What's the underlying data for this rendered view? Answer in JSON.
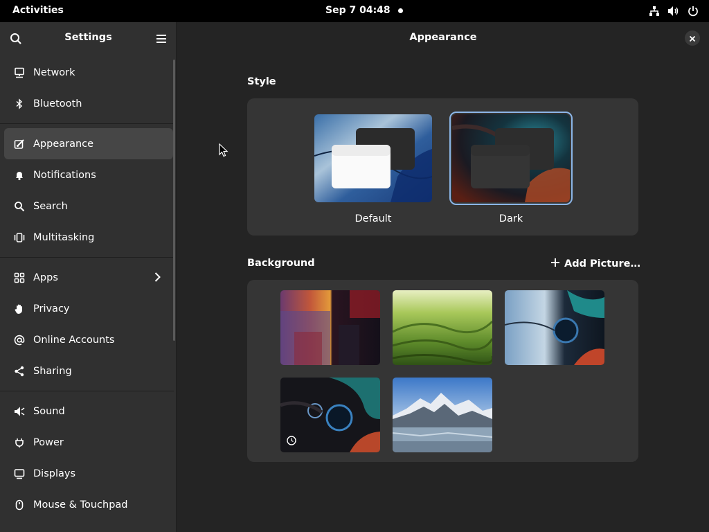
{
  "topbar": {
    "activities": "Activities",
    "clock": "Sep 7  04:48",
    "tray_icons": [
      "network-wired-icon",
      "volume-icon",
      "power-icon"
    ]
  },
  "sidebar": {
    "title": "Settings",
    "items": [
      {
        "label": "Network",
        "icon": "network-icon"
      },
      {
        "label": "Bluetooth",
        "icon": "bluetooth-icon"
      },
      {
        "label": "Appearance",
        "icon": "appearance-icon",
        "active": true
      },
      {
        "label": "Notifications",
        "icon": "bell-icon"
      },
      {
        "label": "Search",
        "icon": "search-icon"
      },
      {
        "label": "Multitasking",
        "icon": "multitasking-icon"
      },
      {
        "label": "Apps",
        "icon": "apps-grid-icon",
        "has_chevron": true
      },
      {
        "label": "Privacy",
        "icon": "hand-icon"
      },
      {
        "label": "Online Accounts",
        "icon": "at-icon"
      },
      {
        "label": "Sharing",
        "icon": "share-icon"
      },
      {
        "label": "Sound",
        "icon": "speaker-icon"
      },
      {
        "label": "Power",
        "icon": "power-plug-icon"
      },
      {
        "label": "Displays",
        "icon": "display-icon"
      },
      {
        "label": "Mouse & Touchpad",
        "icon": "mouse-icon"
      }
    ]
  },
  "main": {
    "title": "Appearance",
    "style": {
      "label": "Style",
      "options": [
        {
          "label": "Default",
          "selected": false
        },
        {
          "label": "Dark",
          "selected": true
        }
      ]
    },
    "background": {
      "label": "Background",
      "add_label": "Add Picture…"
    }
  },
  "colors": {
    "accent": "#8cb6e8",
    "window_bg": "#242424",
    "sidebar_bg": "#303030",
    "card_bg": "#353535"
  }
}
